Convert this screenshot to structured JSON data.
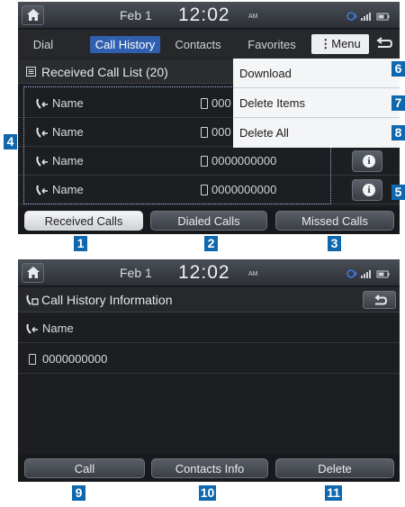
{
  "screen1": {
    "status": {
      "date": "Feb  1",
      "time": "12:02",
      "ampm": "AM"
    },
    "tabs": [
      "Dial",
      "Call History",
      "Contacts",
      "Favorites"
    ],
    "menu_label": "Menu",
    "list_header": "Received Call List (20)",
    "rows": [
      {
        "name": "Name",
        "number": "000"
      },
      {
        "name": "Name",
        "number": "000"
      },
      {
        "name": "Name",
        "number": "0000000000"
      },
      {
        "name": "Name",
        "number": "0000000000"
      }
    ],
    "dropdown": [
      "Download",
      "Delete Items",
      "Delete All"
    ],
    "bottom_buttons": [
      "Received Calls",
      "Dialed Calls",
      "Missed Calls"
    ]
  },
  "screen2": {
    "status": {
      "date": "Feb  1",
      "time": "12:02",
      "ampm": "AM"
    },
    "title": "Call History Information",
    "name": "Name",
    "number": "0000000000",
    "bottom_buttons": [
      "Call",
      "Contacts Info",
      "Delete"
    ]
  },
  "callouts": [
    "1",
    "2",
    "3",
    "4",
    "5",
    "6",
    "7",
    "8",
    "9",
    "10",
    "11"
  ],
  "colors": {
    "callout": "#0f68ae",
    "active_tab": "#2f5fae",
    "screen_bg": "#1d1e21"
  }
}
